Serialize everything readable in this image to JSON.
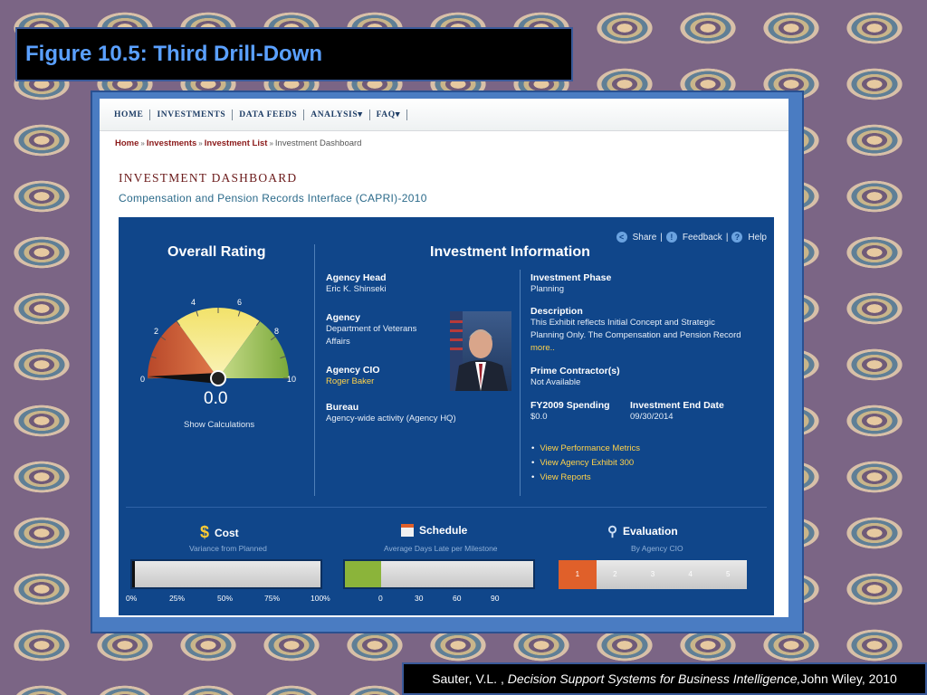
{
  "slide": {
    "title": "Figure 10.5:  Third Drill-Down",
    "caption_author": "Sauter, V.L. , ",
    "caption_book": "Decision Support Systems for Business Intelligence,",
    "caption_publisher": " John Wiley, 2010"
  },
  "nav": {
    "items": [
      "HOME",
      "INVESTMENTS",
      "DATA FEEDS",
      "ANALYSIS",
      "FAQ"
    ],
    "caret": "▾"
  },
  "breadcrumb": {
    "home": "Home",
    "investments": "Investments",
    "list": "Investment List",
    "current": "Investment Dashboard",
    "separator": "»"
  },
  "page": {
    "title": "INVESTMENT DASHBOARD",
    "subtitle": "Compensation and Pension Records Interface (CAPRI)-2010"
  },
  "toplinks": {
    "share": "Share",
    "feedback": "Feedback",
    "help": "Help",
    "divider": "|"
  },
  "rating": {
    "title": "Overall Rating",
    "value": "0.0",
    "value_num": 0,
    "scale": [
      "0",
      "2",
      "4",
      "6",
      "8",
      "10"
    ],
    "show_calc": "Show Calculations"
  },
  "info": {
    "title": "Investment Information",
    "agency_head_label": "Agency Head",
    "agency_head": "Eric K. Shinseki",
    "agency_label": "Agency",
    "agency_line1": "Department of Veterans",
    "agency_line2": "Affairs",
    "cio_label": "Agency CIO",
    "cio": "Roger Baker",
    "bureau_label": "Bureau",
    "bureau": "Agency-wide activity (Agency HQ)",
    "phase_label": "Investment Phase",
    "phase": "Planning",
    "description_label": "Description",
    "description_line1": "This Exhibit reflects Initial Concept and Strategic",
    "description_line2": "Planning Only. The Compensation and Pension Record",
    "more": "more..",
    "contractor_label": "Prime Contractor(s)",
    "contractor": "Not Available",
    "spending_label": "FY2009 Spending",
    "spending": "$0.0",
    "end_date_label": "Investment End Date",
    "end_date": "09/30/2014",
    "links": [
      "View Performance Metrics",
      "View Agency Exhibit 300",
      "View Reports"
    ]
  },
  "metrics": {
    "cost": {
      "title": "Cost",
      "subtitle": "Variance from Planned",
      "ticks": [
        "0%",
        "25%",
        "50%",
        "75%",
        "100%"
      ],
      "fill": 0
    },
    "schedule": {
      "title": "Schedule",
      "subtitle": "Average Days Late per Milestone",
      "ticks": [
        "0",
        "30",
        "60",
        "90"
      ],
      "fill_color": "#8bb43a"
    },
    "evaluation": {
      "title": "Evaluation",
      "subtitle": "By Agency CIO",
      "levels": [
        "1",
        "2",
        "3",
        "4",
        "5"
      ],
      "selected": 1,
      "selected_color": "#e0602a"
    }
  },
  "colors": {
    "panel": "#10468a",
    "link": "#ffd24a",
    "title_blue": "#5aa0ff"
  }
}
